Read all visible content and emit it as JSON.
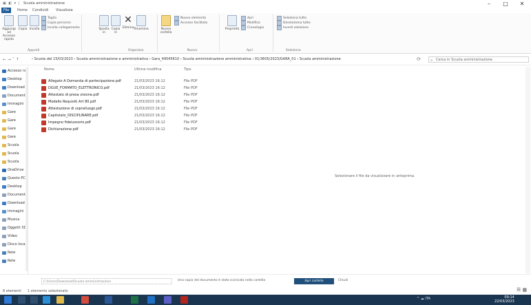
{
  "window": {
    "title": "Scuola amministrazione",
    "quick_access_glyphs": "▣ ◧ ▾ |",
    "minimize": "–",
    "maximize": "□",
    "close": "✕"
  },
  "ribbon_tabs": [
    {
      "label": "File",
      "active": true
    },
    {
      "label": "Home",
      "active": false
    },
    {
      "label": "Condividi",
      "active": false
    },
    {
      "label": "Visualizza",
      "active": false
    }
  ],
  "ribbon": {
    "clipboard": {
      "pin_label": "Aggiungi ad Accesso rapido",
      "copy_label": "Copia",
      "paste_label": "Incolla",
      "cut_label": "Taglia",
      "copy_path_label": "Copia percorso",
      "paste_shortcut_label": "Incolla collegamento",
      "group_label": "Appunti"
    },
    "organize": {
      "move_label": "Sposta in",
      "copy_to_label": "Copia in",
      "delete_label": "Elimina",
      "rename_label": "Rinomina",
      "group_label": "Organizza"
    },
    "new": {
      "new_folder_label": "Nuova cartella",
      "new_item_label": "Nuovo elemento",
      "easy_access_label": "Accesso facilitato",
      "group_label": "Nuovo"
    },
    "open": {
      "properties_label": "Proprietà",
      "open_label": "Apri",
      "edit_label": "Modifica",
      "history_label": "Cronologia",
      "group_label": "Apri"
    },
    "select": {
      "select_all_label": "Seleziona tutto",
      "select_none_label": "Deseleziona tutto",
      "invert_label": "Inverti selezione",
      "group_label": "Seleziona"
    }
  },
  "address": {
    "nav_glyphs": "←  →  ˅  ↑",
    "breadcrumbs": "›  Scuola del 15/03/2023  ›  Scuola amministrazione e amministrativa  ›  Gara_49545610  ›  Scuola amministrazione amministrativa  ›  01/3605/2023/GARA_01  ›  Scuola amministrazione",
    "refresh_glyph": "⟳",
    "search_placeholder": "Cerca in Scuola amministrazione"
  },
  "nav_pane": {
    "items": [
      {
        "label": "Accesso rapido",
        "color": "#2f6db5"
      },
      {
        "label": "Desktop",
        "color": "#3d7cc9"
      },
      {
        "label": "Download",
        "color": "#3d7cc9"
      },
      {
        "label": "Documenti",
        "color": "#8aa0bb"
      },
      {
        "label": "Immagini",
        "color": "#5a8fce"
      },
      {
        "label": "Gare",
        "color": "#e0b94a"
      },
      {
        "label": "Gare",
        "color": "#e0b94a"
      },
      {
        "label": "Gare",
        "color": "#e0b94a"
      },
      {
        "label": "Gare",
        "color": "#e0b94a"
      },
      {
        "label": "Scuola",
        "color": "#e0b94a"
      },
      {
        "label": "Scuola",
        "color": "#e0b94a"
      },
      {
        "label": "Scuola",
        "color": "#e0b94a"
      },
      {
        "label": "OneDrive",
        "color": "#2f6db5"
      },
      {
        "label": "Questo PC",
        "color": "#4a7fb8"
      },
      {
        "label": "Desktop",
        "color": "#3d7cc9"
      },
      {
        "label": "Documenti",
        "color": "#8aa0bb"
      },
      {
        "label": "Download",
        "color": "#3d7cc9"
      },
      {
        "label": "Immagini",
        "color": "#5a8fce"
      },
      {
        "label": "Musica",
        "color": "#8aa0bb"
      },
      {
        "label": "Oggetti 3D",
        "color": "#8aa0bb"
      },
      {
        "label": "Video",
        "color": "#8aa0bb"
      },
      {
        "label": "Disco locale",
        "color": "#8aa0bb"
      },
      {
        "label": "Rete",
        "color": "#4a7fb8"
      },
      {
        "label": "Rete",
        "color": "#4a7fb8"
      }
    ]
  },
  "file_list": {
    "columns": {
      "name": "Nome",
      "date": "Ultima modifica",
      "type": "Tipo"
    },
    "files": [
      {
        "name": "Allegato A Domanda di partecipazione.pdf",
        "date": "21/03/2023 16:12",
        "type": "File PDF"
      },
      {
        "name": "DGUE_FORMATO_ELETTRONICO.pdf",
        "date": "21/03/2023 16:12",
        "type": "File PDF"
      },
      {
        "name": "Attestato di presa visione.pdf",
        "date": "21/03/2023 16:12",
        "type": "File PDF"
      },
      {
        "name": "Modello Requisiti Art 80.pdf",
        "date": "21/03/2023 16:12",
        "type": "File PDF"
      },
      {
        "name": "Attestazione di sopralluogo.pdf",
        "date": "21/03/2023 16:12",
        "type": "File PDF"
      },
      {
        "name": "Capitolato_DISCIPLINARE.pdf",
        "date": "21/03/2023 16:12",
        "type": "File PDF"
      },
      {
        "name": "Impegno fideiussorio.pdf",
        "date": "21/03/2023 16:12",
        "type": "File PDF"
      },
      {
        "name": "Dichiarazione.pdf",
        "date": "21/03/2023 16:12",
        "type": "File PDF"
      }
    ]
  },
  "empty_hint": "Selezionare il file da visualizzare in anteprima.",
  "download_bar": {
    "field_text": "C:\\Users\\Download\\Scuola amministrazione",
    "message": "Una copia del documento è stata scaricata nella cartella",
    "open_label": "Apri cartella",
    "cancel_label": "Chiudi"
  },
  "status": {
    "count": "8 elementi",
    "selection": "1 elemento selezionato",
    "view_glyphs": "☰ ▦"
  },
  "taskbar": {
    "apps": [
      {
        "name": "start",
        "color": "#2f7ad6"
      },
      {
        "name": "search",
        "color": "#2f4f6f"
      },
      {
        "name": "task-view",
        "color": "#2f4f6f"
      },
      {
        "name": "edge",
        "color": "#2c8fd6"
      },
      {
        "name": "explorer",
        "color": "#e0b94a"
      },
      {
        "name": "chrome",
        "color": "#d34c3c"
      },
      {
        "name": "word",
        "color": "#2b5797"
      },
      {
        "name": "excel",
        "color": "#1e7145"
      },
      {
        "name": "outlook",
        "color": "#1f6fc5"
      },
      {
        "name": "teams",
        "color": "#5b5fc7"
      },
      {
        "name": "acrobat",
        "color": "#b3261e"
      }
    ],
    "tray_text": "^  ☁  ITA",
    "time": "09:14",
    "date": "22/03/2023"
  }
}
